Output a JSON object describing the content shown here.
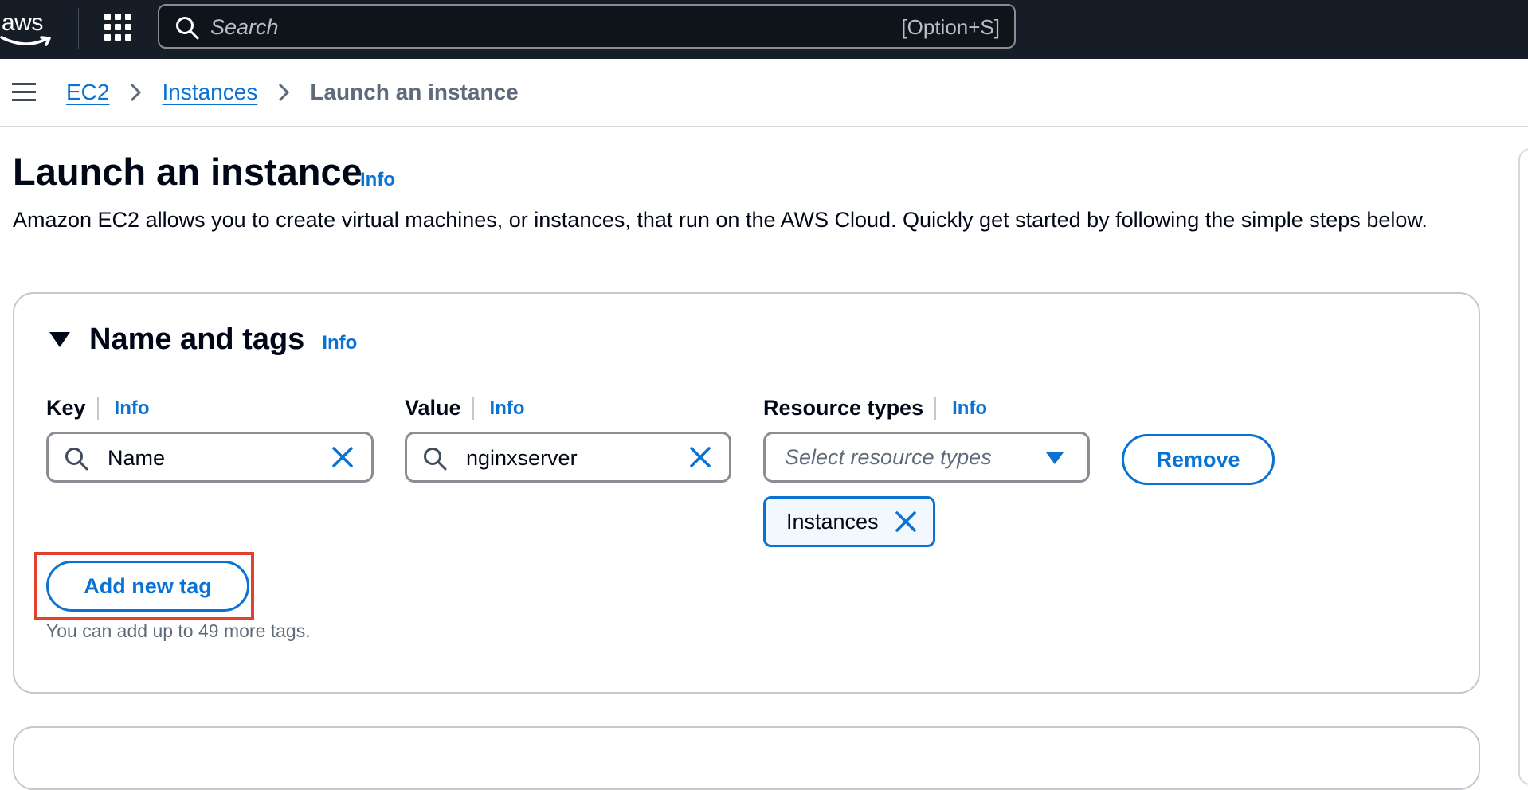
{
  "header": {
    "logo_text": "aws",
    "search": {
      "placeholder": "Search",
      "shortcut": "[Option+S]"
    }
  },
  "breadcrumb": {
    "items": [
      "EC2",
      "Instances"
    ],
    "current": "Launch an instance"
  },
  "page": {
    "title": "Launch an instance",
    "info_label": "Info",
    "description": "Amazon EC2 allows you to create virtual machines, or instances, that run on the AWS Cloud. Quickly get started by following the simple steps below."
  },
  "name_and_tags": {
    "title": "Name and tags",
    "info_label": "Info",
    "key": {
      "label": "Key",
      "info": "Info",
      "value": "Name"
    },
    "value": {
      "label": "Value",
      "info": "Info",
      "value": "nginxserver"
    },
    "resource_types": {
      "label": "Resource types",
      "info": "Info",
      "placeholder": "Select resource types",
      "selected": [
        "Instances"
      ]
    },
    "remove_label": "Remove",
    "add_tag_label": "Add new tag",
    "hint": "You can add up to 49 more tags."
  },
  "colors": {
    "topbar": "#161d26",
    "link": "#0972d3",
    "highlight": "#e0402c"
  }
}
